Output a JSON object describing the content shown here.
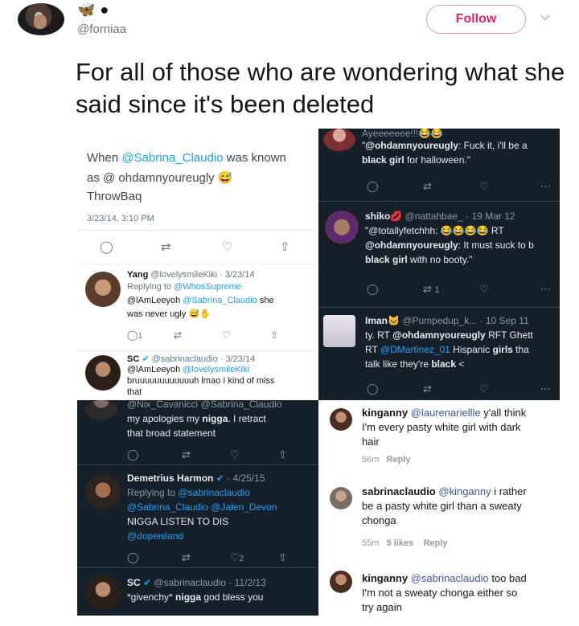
{
  "tweet": {
    "avatar": "profile-photo",
    "name_emojis": [
      "butterfly-emoji",
      "black-heart-emoji"
    ],
    "handle": "@forniaa",
    "follow_label": "Follow",
    "text": "For all of those who are wondering what she said since it's been deleted"
  },
  "panel_a": {
    "text_1": "When ",
    "mention": "@Sabrina_Claudio",
    "text_2": " was known",
    "text_3": "as @ ohdamnyoureugly",
    "text_4": "ThrowBaq",
    "timestamp": "3/23/14, 3:10 PM"
  },
  "panel_b": {
    "top": "Ayeeeeeee!!!",
    "mention": "@ohdamnyoureugly",
    "line1_rest": ": Fuck it, i'll be a",
    "line2": "black girl",
    "line2_rest": " for halloween.\"",
    "quote_open": "\""
  },
  "panel_c": {
    "name": "Yang",
    "handle": "@lovelysmileKiki · 3/23/14",
    "replying_label": "Replying to ",
    "replying_to": "@WhosSupreme",
    "body_1": "@lAmLeeyoh ",
    "body_mention": "@Sabrina_Claudio",
    "body_2": " she",
    "body_3": "was never ugly",
    "like_count": "1"
  },
  "panel_d": {
    "name": "SC",
    "handle": "@sabrinaclaudio · 3/23/14",
    "line1": "@lAmLeeyoh ",
    "line1_mention": "@lovelysmileKiki",
    "line2": "bruuuuuuuuuuuuh lmao I kind of miss",
    "line3": "that"
  },
  "panel_e": {
    "name": "shiko",
    "handle": "@nattahbae_ · 19 Mar 12",
    "line1": "\"@totallyfetchhh: ",
    "line1_rt": " RT",
    "line2_mention": "@ohdamnyoureugly",
    "line2_rest": ": It must suck to b",
    "line3": "black girl",
    "line3_rest": " with no booty.\"",
    "retweet_count": "1"
  },
  "panel_f": {
    "name": "Iman",
    "handle": "@Pumpedup_k... · 10 Sep 11",
    "line1": "ty. RT ",
    "line1_mention": "@ohdamnyoureugly",
    "line1_rest": " RFT Ghett",
    "line2": "RT ",
    "line2_mention": "@DMartinez_01",
    "line2_rest": " Hispanic ",
    "line2_bold": "girls",
    "line2_end": " tha",
    "line3": "talk like they're ",
    "line3_bold": "black",
    "line3_end": " <"
  },
  "panel_g": {
    "top": "@Nix_Cavanicci @Sabrina_Claudio",
    "line1": "my apologies my ",
    "line1_bold": "nigga",
    "line1_rest": ". I retract",
    "line2": "that broad statement"
  },
  "panel_h": {
    "name": "Demetrius Harmon",
    "handle": "· 4/25/15",
    "replying_label": "Replying to ",
    "replying_to": "@sabrinaclaudio",
    "line1_m1": "@Sabrina_Claudio",
    "line1_m2": " @Jalen_Devon",
    "line2": "NIGGA LISTEN TO DIS",
    "line3": "@dopeisland",
    "like_count": "2"
  },
  "panel_i": {
    "name": "SC",
    "handle": "@sabrinaclaudio · 11/2/13",
    "line1": "*givenchy* ",
    "line1_bold": "nigga",
    "line1_rest": " god bless you"
  },
  "panel_j": {
    "c1_user": "kinganny",
    "c1_mention": "@laurenariellle",
    "c1_text_1": " y'all think",
    "c1_text_2": "I'm every pasty white girl with dark",
    "c1_text_3": "hair",
    "c1_time": "56m",
    "c1_reply": "Reply",
    "c2_user": "sabrinaclaudio",
    "c2_mention": "@kinganny",
    "c2_text_1": " i rather",
    "c2_text_2": "be a pasty white girl than a sweaty",
    "c2_text_3": "chonga",
    "c2_time": "55m",
    "c2_likes": "5 likes",
    "c2_reply": "Reply",
    "c3_user": "kinganny",
    "c3_mention": "@sabrinaclaudio",
    "c3_text_1": " too bad",
    "c3_text_2": "I'm not a sweaty chonga either so",
    "c3_text_3": "try again"
  },
  "colors": {
    "follow": "#e0245e",
    "link": "#1da1f2",
    "dark_bg": "#15202b"
  }
}
